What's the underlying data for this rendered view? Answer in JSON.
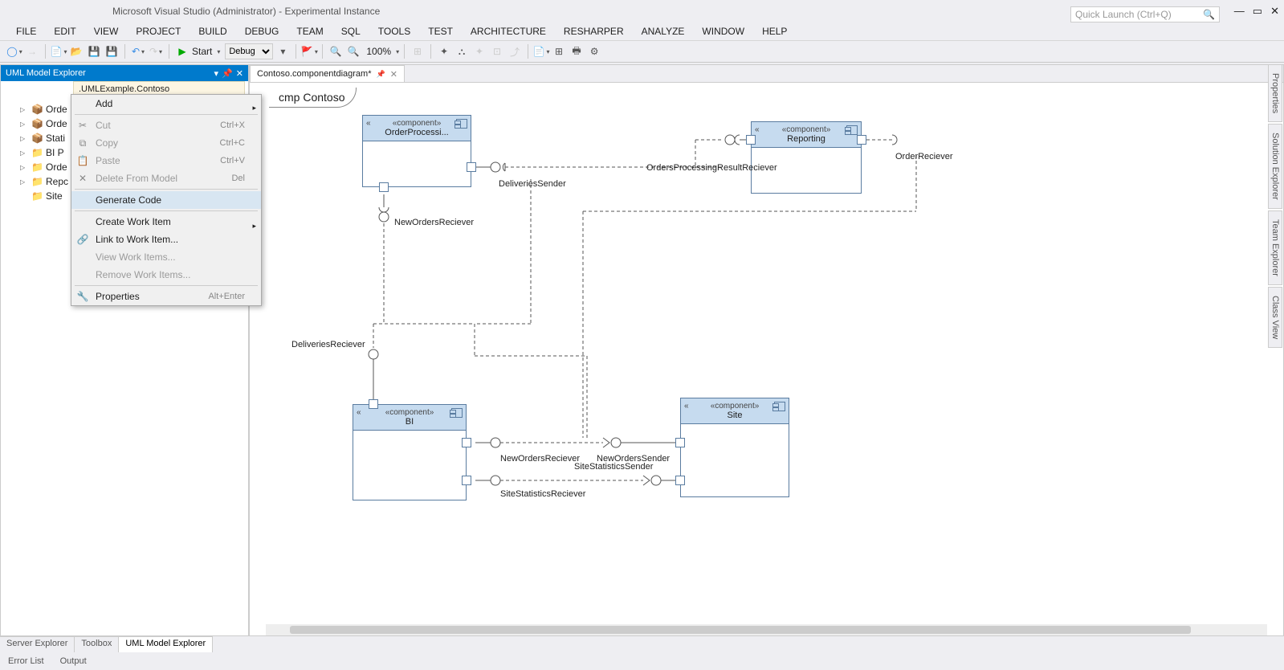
{
  "title": "Microsoft Visual Studio (Administrator) - Experimental Instance",
  "quick_launch": {
    "placeholder": "Quick Launch (Ctrl+Q)"
  },
  "menubar": [
    "FILE",
    "EDIT",
    "VIEW",
    "PROJECT",
    "BUILD",
    "DEBUG",
    "TEAM",
    "SQL",
    "TOOLS",
    "TEST",
    "ARCHITECTURE",
    "RESHARPER",
    "ANALYZE",
    "WINDOW",
    "HELP"
  ],
  "toolbar": {
    "start": "Start",
    "config": "Debug",
    "zoom": "100%"
  },
  "panel": {
    "title": "UML Model Explorer",
    "namespace": ".UMLExample.Contoso",
    "tree": [
      "Orde",
      "Orde",
      "Stati",
      "BI P",
      "Orde",
      "Repc",
      "Site"
    ]
  },
  "context_menu": [
    {
      "label": "Add",
      "type": "sub"
    },
    {
      "type": "sep"
    },
    {
      "label": "Cut",
      "shortcut": "Ctrl+X",
      "disabled": true,
      "icon": "✂"
    },
    {
      "label": "Copy",
      "shortcut": "Ctrl+C",
      "disabled": true,
      "icon": "⧉"
    },
    {
      "label": "Paste",
      "shortcut": "Ctrl+V",
      "disabled": true,
      "icon": "📋"
    },
    {
      "label": "Delete From Model",
      "shortcut": "Del",
      "disabled": true,
      "icon": "✕"
    },
    {
      "type": "sep"
    },
    {
      "label": "Generate Code",
      "hover": true
    },
    {
      "type": "sep"
    },
    {
      "label": "Create Work Item",
      "type": "sub"
    },
    {
      "label": "Link to Work Item...",
      "icon": "🔗"
    },
    {
      "label": "View Work Items...",
      "disabled": true
    },
    {
      "label": "Remove Work Items...",
      "disabled": true
    },
    {
      "type": "sep"
    },
    {
      "label": "Properties",
      "shortcut": "Alt+Enter",
      "icon": "🔧"
    }
  ],
  "doc_tab": "Contoso.componentdiagram*",
  "diagram": {
    "title": "cmp Contoso",
    "stereo": "«component»",
    "components": {
      "order": "OrderProcessi...",
      "reporting": "Reporting",
      "bi": "BI",
      "site": "Site"
    },
    "labels": {
      "deliveries_sender": "DeliveriesSender",
      "orders_result": "OrdersProcessingResultReciever",
      "order_reciever": "OrderReciever",
      "new_orders_rec": "NewOrdersReciever",
      "deliveries_rec": "DeliveriesReciever",
      "new_orders_rec2": "NewOrdersReciever",
      "new_orders_sender": "NewOrdersSender",
      "site_stats_sender": "SiteStatisticsSender",
      "site_stats_rec": "SiteStatisticsReciever"
    }
  },
  "side_tabs": [
    "Properties",
    "Solution Explorer",
    "Team Explorer",
    "Class View"
  ],
  "bottom_tabs": [
    "Server Explorer",
    "Toolbox",
    "UML Model Explorer"
  ],
  "status_tabs": [
    "Error List",
    "Output"
  ]
}
